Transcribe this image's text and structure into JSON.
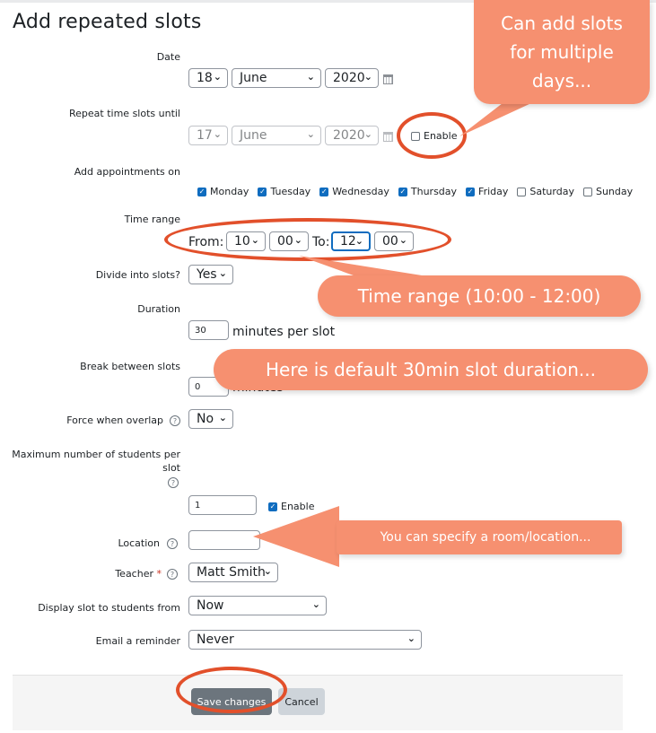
{
  "page": {
    "title": "Add repeated slots"
  },
  "date": {
    "label": "Date",
    "day": "18",
    "month": "June",
    "year": "2020"
  },
  "repeat": {
    "label": "Repeat time slots until",
    "day": "17",
    "month": "June",
    "year": "2020",
    "enable": "Enable"
  },
  "appointments": {
    "label": "Add appointments on",
    "days": [
      {
        "name": "Monday",
        "checked": true
      },
      {
        "name": "Tuesday",
        "checked": true
      },
      {
        "name": "Wednesday",
        "checked": true
      },
      {
        "name": "Thursday",
        "checked": true
      },
      {
        "name": "Friday",
        "checked": true
      },
      {
        "name": "Saturday",
        "checked": false
      },
      {
        "name": "Sunday",
        "checked": false
      }
    ]
  },
  "time_range": {
    "label": "Time range",
    "from_label": "From:",
    "from_hour": "10",
    "from_min": "00",
    "to_label": "To:",
    "to_hour": "12",
    "to_min": "00"
  },
  "divide": {
    "label": "Divide into slots?",
    "value": "Yes"
  },
  "duration": {
    "label": "Duration",
    "value": "30",
    "unit": "minutes per slot"
  },
  "break": {
    "label": "Break between slots",
    "value": "0",
    "unit": "minutes"
  },
  "force": {
    "label": "Force when overlap",
    "value": "No"
  },
  "max_students": {
    "label_line1": "Maximum number of students per",
    "label_line2": "slot",
    "value": "1",
    "enable": "Enable"
  },
  "location": {
    "label": "Location",
    "value": ""
  },
  "teacher": {
    "label": "Teacher",
    "required_mark": "*",
    "value": "Matt Smith"
  },
  "display_slot": {
    "label": "Display slot to students from",
    "value": "Now"
  },
  "email": {
    "label": "Email a reminder",
    "value": "Never"
  },
  "buttons": {
    "save": "Save changes",
    "cancel": "Cancel"
  },
  "callouts": {
    "multi_days": "Can add slots for multiple days...",
    "time_range": "Time range (10:00 - 12:00)",
    "duration": "Here is default 30min slot duration...",
    "location": "You can specify a room/location..."
  },
  "colors": {
    "accent": "#0f6cbf",
    "callout": "#f69070",
    "ring": "#e2502b",
    "required": "#ca3120"
  },
  "icons": {
    "help": "question-circle-icon",
    "calendar": "calendar-icon",
    "select": "chevron-down-icon"
  }
}
